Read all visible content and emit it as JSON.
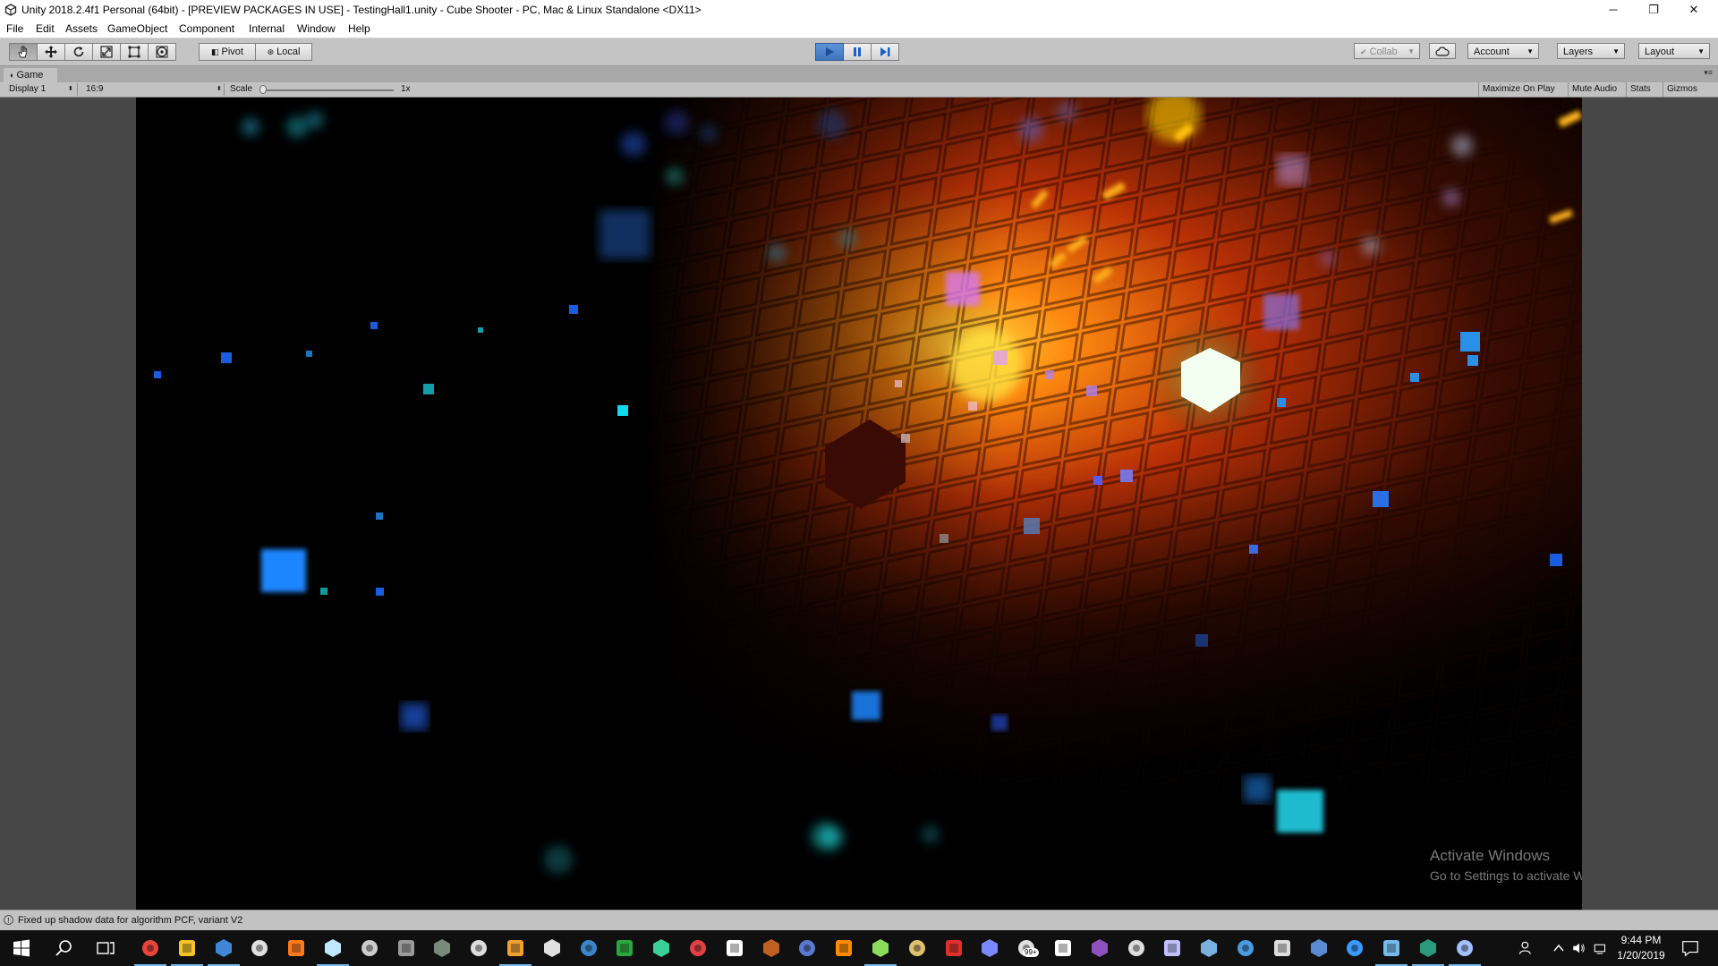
{
  "window": {
    "title": "Unity 2018.2.4f1 Personal (64bit) - [PREVIEW PACKAGES IN USE] - TestingHall1.unity - Cube Shooter - PC, Mac & Linux Standalone <DX11>",
    "minimize_glyph": "─",
    "maximize_glyph": "❐",
    "close_glyph": "✕"
  },
  "menu": [
    "File",
    "Edit",
    "Assets",
    "GameObject",
    "Component",
    "Internal",
    "Window",
    "Help"
  ],
  "toolbar": {
    "tools": [
      "hand-tool",
      "move-tool",
      "rotate-tool",
      "scale-tool",
      "rect-tool",
      "transform-tool"
    ],
    "pivot_label": "Pivot",
    "local_label": "Local",
    "play_state": "playing",
    "collab_label": "Collab",
    "account_label": "Account",
    "layers_label": "Layers",
    "layout_label": "Layout"
  },
  "game_tab": {
    "label": "Game",
    "display": "Display 1",
    "aspect": "16:9",
    "scale_label": "Scale",
    "scale_value": "1x",
    "scale_level": 0.0,
    "maximize_on_play": "Maximize On Play",
    "mute_audio": "Mute Audio",
    "stats": "Stats",
    "gizmos": "Gizmos"
  },
  "watermark": {
    "title": "Activate Windows",
    "subtitle": "Go to Settings to activate Windows."
  },
  "status": {
    "message": "Fixed up shadow data for algorithm PCF, variant V2"
  },
  "taskbar": {
    "apps": [
      "start",
      "search",
      "task-view",
      "chrome",
      "file-explorer",
      "steam",
      "epic-games",
      "origin",
      "notepad",
      "calculator",
      "terminal",
      "game-controller",
      "sublime",
      "unity",
      "blender",
      "uplay",
      "razer",
      "gitkraken",
      "helmet",
      "media-player",
      "paint",
      "inkscape",
      "vlc",
      "notepad-plus",
      "library",
      "filezilla",
      "discord",
      "mail",
      "twitch",
      "app-x",
      "edge",
      "visual-studio",
      "obs",
      "app-bar",
      "capcut",
      "davinci",
      "sourcetree",
      "steam-2",
      "app-green",
      "app-blue"
    ],
    "time": "9:44 PM",
    "date": "1/20/2019",
    "mail_badge": "99+",
    "accent": "#76b9ed"
  },
  "colors": {
    "toolbar_bg": "#c4c4c4",
    "play_blue": "#4a80c9",
    "viewport_border": "#474747"
  }
}
